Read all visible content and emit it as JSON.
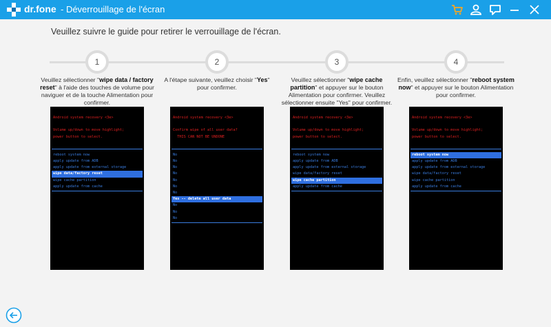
{
  "app": {
    "brand": "dr.fone",
    "title": "- Déverrouillage de l'écran"
  },
  "instruction": "Veuillez suivre le guide pour retirer le verrouillage de l'écran.",
  "steps": [
    {
      "number": "1",
      "desc": [
        "Veuillez sélectionner \"",
        {
          "b": "wipe data / factory reset"
        },
        "\" à l'aide des touches de volume pour naviguer et de la touche Alimentation pour confirmer."
      ],
      "screen": {
        "header": [
          "Android system recovery <3e>",
          "",
          "Volume up/down to move highlight;",
          "power button to select."
        ],
        "items": [
          "reboot system now",
          "apply update from ADB",
          "apply update from external storage",
          "wipe data/factory reset",
          "wipe cache partition",
          "apply update from cache"
        ],
        "selected": 3
      }
    },
    {
      "number": "2",
      "desc": [
        "A l'étape suivante, veuillez choisir \"",
        {
          "b": "Yes"
        },
        "\" pour confirmer."
      ],
      "screen": {
        "header": [
          "Android system recovery <3e>",
          "",
          "Confirm wipe of all user data?",
          "  THIS CAN NOT BE UNDONE"
        ],
        "items": [
          "No",
          "No",
          "No",
          "No",
          "No",
          "No",
          "No",
          "Yes -- delete all user data",
          "No",
          "No",
          "No"
        ],
        "selected": 7
      }
    },
    {
      "number": "3",
      "desc": [
        "Veuillez sélectionner \"",
        {
          "b": "wipe cache partition"
        },
        "\" et appuyer sur le bouton Alimentation pour confirmer. Veuillez sélectionner ensuite \"Yes\" pour confirmer."
      ],
      "screen": {
        "header": [
          "Android system recovery <3e>",
          "",
          "Volume up/down to move highlight;",
          "power button to select."
        ],
        "items": [
          "reboot system now",
          "apply update from ADB",
          "apply update from external storage",
          "wipe data/factory reset",
          "wipe cache partition",
          "apply update from cache"
        ],
        "selected": 4
      }
    },
    {
      "number": "4",
      "desc": [
        "Enfin, veuillez sélectionner \"",
        {
          "b": "reboot system now"
        },
        "\" et appuyer sur le bouton Alimentation pour confirmer."
      ],
      "screen": {
        "header": [
          "Android system recovery <3e>",
          "",
          "Volume up/down to move highlight;",
          "power button to select."
        ],
        "items": [
          "reboot system now",
          "apply update from ADB",
          "apply update from external storage",
          "wipe data/factory reset",
          "wipe cache partition",
          "apply update from cache"
        ],
        "selected": 0
      }
    }
  ],
  "icons": {
    "logo": "plus-logo-icon",
    "cart": "cart-icon",
    "user": "user-icon",
    "feedback": "chat-icon",
    "minimize": "minimize-icon",
    "close": "close-icon",
    "back": "back-arrow-icon"
  },
  "colors": {
    "titlebar": "#1aa0e8",
    "cart": "#f5a623",
    "recovery_red": "#e02020",
    "recovery_blue": "#3a7de0",
    "recovery_highlight": "#2f6fe0"
  }
}
